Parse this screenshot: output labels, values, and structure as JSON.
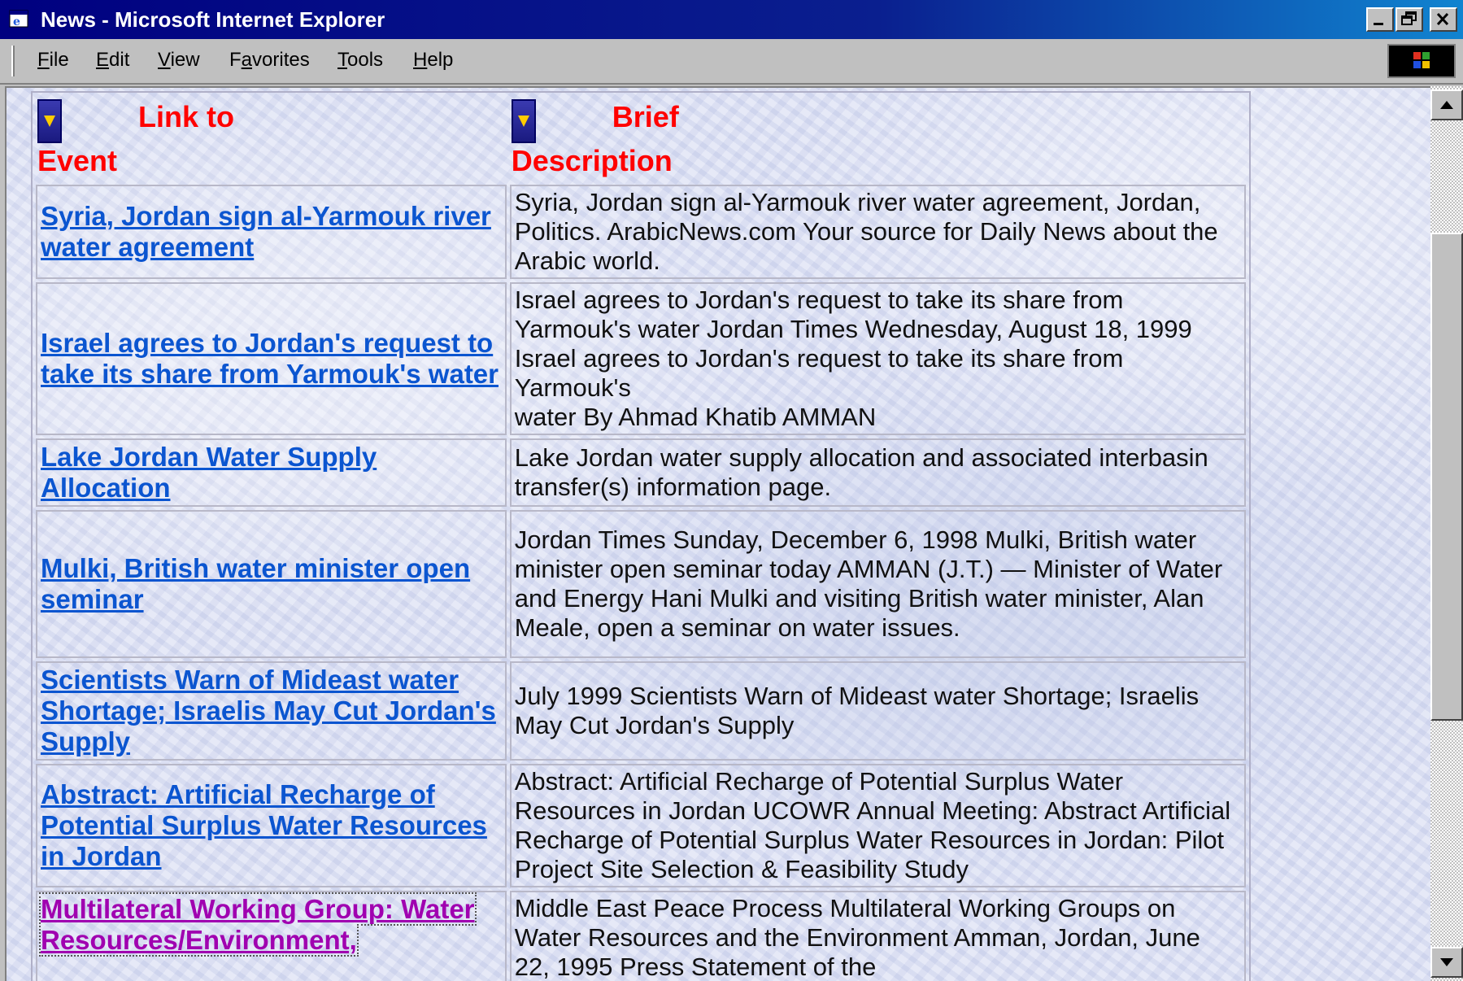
{
  "window": {
    "title": "News - Microsoft Internet Explorer",
    "controls": {
      "minimize": "_",
      "maximize": "▣",
      "close": "✕"
    }
  },
  "menubar": {
    "items": [
      {
        "label": "File",
        "key": "F",
        "rest": "ile"
      },
      {
        "label": "Edit",
        "key": "E",
        "rest": "dit"
      },
      {
        "label": "View",
        "key": "V",
        "rest": "iew"
      },
      {
        "label": "Favorites",
        "key": "a",
        "pre": "F",
        "rest": "vorites"
      },
      {
        "label": "Tools",
        "key": "T",
        "rest": "ools"
      },
      {
        "label": "Help",
        "key": "H",
        "rest": "elp"
      }
    ]
  },
  "table": {
    "headers": {
      "link": {
        "line1": "Link to",
        "line2": "Event"
      },
      "desc": {
        "line1": "Brief",
        "line2": "Description"
      }
    },
    "rows": [
      {
        "link": "Syria, Jordan sign al-Yarmouk river water agreement",
        "desc": "Syria, Jordan sign al-Yarmouk river water agreement, Jordan, Politics. ArabicNews.com Your source for Daily News about the Arabic world."
      },
      {
        "link": "Israel agrees to Jordan's request to take its share from Yarmouk's water",
        "desc": "Israel agrees to Jordan's request to take its share from Yarmouk's water Jordan Times Wednesday, August 18, 1999 Israel agrees to Jordan's request to take its share from Yarmouk's",
        "desc2": "water By Ahmad Khatib AMMAN"
      },
      {
        "link": "Lake Jordan Water Supply Allocation",
        "desc": "Lake Jordan water supply allocation and associated interbasin transfer(s) information page."
      },
      {
        "link": "Mulki, British water minister open seminar",
        "desc": "Jordan Times Sunday, December 6, 1998 Mulki, British water minister open seminar today AMMAN (J.T.) — Minister of Water and Energy Hani Mulki and visiting British water minister, Alan Meale, open a seminar on water issues."
      },
      {
        "link": "Scientists Warn of Mideast water Shortage; Israelis May Cut Jordan's Supply",
        "desc": "July 1999 Scientists Warn of Mideast water Shortage; Israelis May Cut Jordan's Supply"
      },
      {
        "link": "Abstract: Artificial Recharge of Potential Surplus Water Resources in Jordan",
        "desc": "Abstract: Artificial Recharge of Potential Surplus Water Resources in Jordan UCOWR Annual Meeting: Abstract Artificial Recharge of Potential Surplus Water Resources in Jordan: Pilot Project Site Selection & Feasibility Study"
      },
      {
        "link": "Multilateral Working Group: Water Resources/Environment,",
        "desc": "Middle East Peace Process Multilateral Working Groups on Water Resources and the Environment Amman, Jordan, June 22, 1995 Press Statement of the"
      }
    ]
  },
  "colors": {
    "title_bar": "#000080",
    "link": "#0b55d0",
    "visited_link": "#a000b0",
    "header_text": "#ff0000"
  }
}
